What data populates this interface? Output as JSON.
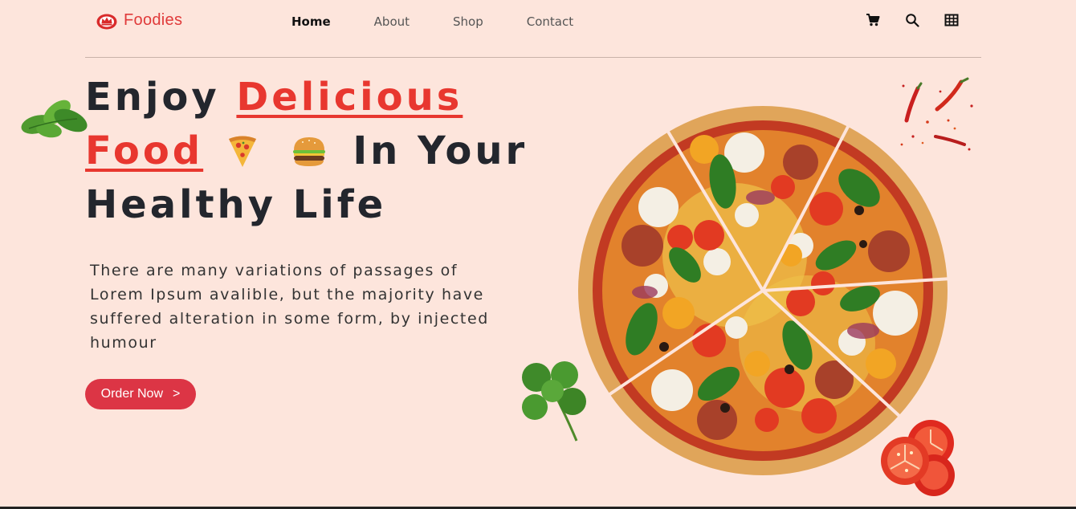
{
  "header": {
    "logo_text": "Foodies",
    "logo_icon": "crown-dish-icon",
    "nav": [
      {
        "label": "Home",
        "active": true
      },
      {
        "label": "About",
        "active": false
      },
      {
        "label": "Shop",
        "active": false
      },
      {
        "label": "Contact",
        "active": false
      }
    ],
    "icons": [
      "cart-icon",
      "search-icon",
      "grid-icon"
    ]
  },
  "hero": {
    "title": {
      "word_enjoy": "Enjoy",
      "word_delicious": "Delicious",
      "word_food": "Food",
      "words_in_your": "In Your",
      "line3": "Healthy Life"
    },
    "emojis": [
      "pizza-emoji",
      "burger-emoji"
    ],
    "description": "There are many variations of passages of Lorem Ipsum avalible, but the majority have suffered alteration in some form, by injected humour",
    "button": {
      "label": "Order Now",
      "arrow": ">"
    }
  },
  "images": [
    "mint-leaves-image",
    "pizza-image",
    "chili-peppers-image",
    "cilantro-image",
    "tomato-slices-image"
  ],
  "colors": {
    "background": "#fde5dc",
    "accent": "#e8372f",
    "button": "#dc3545",
    "text": "#23262d"
  }
}
